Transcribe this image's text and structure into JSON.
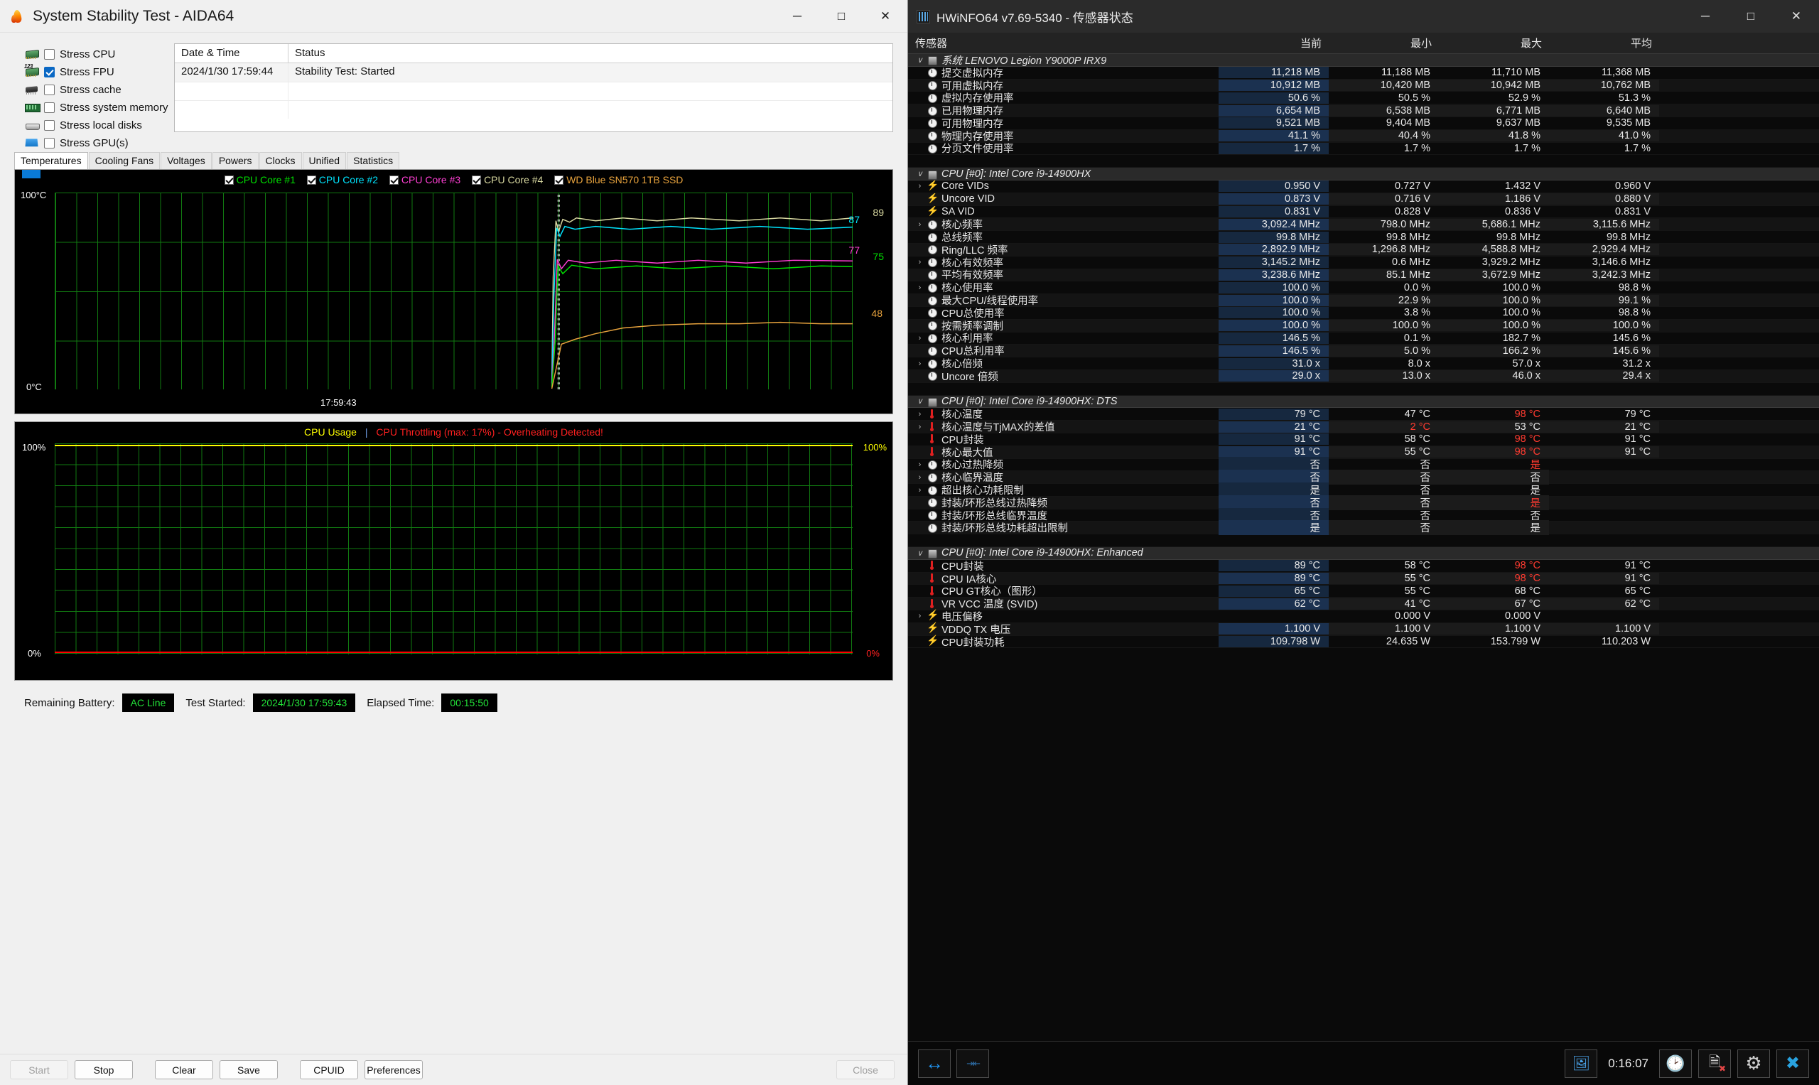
{
  "aida": {
    "title": "System Stability Test - AIDA64",
    "window_buttons": {
      "minimize": "─",
      "maximize": "□",
      "close": "✕"
    },
    "stress_options": [
      {
        "label": "Stress CPU",
        "checked": false,
        "icon": "cpu-icon"
      },
      {
        "label": "Stress FPU",
        "checked": true,
        "icon": "fpu-icon"
      },
      {
        "label": "Stress cache",
        "checked": false,
        "icon": "cache-icon"
      },
      {
        "label": "Stress system memory",
        "checked": false,
        "icon": "memory-icon"
      },
      {
        "label": "Stress local disks",
        "checked": false,
        "icon": "disk-icon"
      },
      {
        "label": "Stress GPU(s)",
        "checked": false,
        "icon": "gpu-icon"
      }
    ],
    "log": {
      "columns": [
        "Date & Time",
        "Status"
      ],
      "rows": [
        {
          "datetime": "2024/1/30 17:59:44",
          "status": "Stability Test: Started"
        }
      ]
    },
    "tabs": [
      {
        "label": "Temperatures",
        "active": true
      },
      {
        "label": "Cooling Fans",
        "active": false
      },
      {
        "label": "Voltages",
        "active": false
      },
      {
        "label": "Powers",
        "active": false
      },
      {
        "label": "Clocks",
        "active": false
      },
      {
        "label": "Unified",
        "active": false
      },
      {
        "label": "Statistics",
        "active": false
      }
    ],
    "temp_graph": {
      "legend": [
        {
          "label": "CPU Core #1",
          "color": "#00e000",
          "checked": true
        },
        {
          "label": "CPU Core #2",
          "color": "#00e5ff",
          "checked": true
        },
        {
          "label": "CPU Core #3",
          "color": "#ff3fd4",
          "checked": true
        },
        {
          "label": "CPU Core #4",
          "color": "#d8d8a0",
          "checked": true
        },
        {
          "label": "WD Blue SN570 1TB SSD",
          "color": "#e8a33d",
          "checked": true
        }
      ],
      "y_max_label": "100°C",
      "y_min_label": "0°C",
      "x_label": "17:59:43",
      "value_labels": [
        {
          "value": "89",
          "color": "#d8d8a0"
        },
        {
          "value": "87",
          "color": "#00e5ff"
        },
        {
          "value": "77",
          "color": "#ff3fd4"
        },
        {
          "value": "75",
          "color": "#00e000"
        },
        {
          "value": "48",
          "color": "#e8a33d"
        }
      ]
    },
    "usage_graph": {
      "title": "CPU Usage",
      "separator": "|",
      "warning": "CPU Throttling (max: 17%) - Overheating Detected!",
      "y_max_label": "100%",
      "y_min_label": "0%",
      "right_max_label": "100%",
      "right_min_label": "0%"
    },
    "status": {
      "battery_label": "Remaining Battery:",
      "battery_value": "AC Line",
      "started_label": "Test Started:",
      "started_value": "2024/1/30 17:59:43",
      "elapsed_label": "Elapsed Time:",
      "elapsed_value": "00:15:50"
    },
    "buttons": [
      {
        "label": "Start",
        "disabled": true
      },
      {
        "label": "Stop",
        "disabled": false
      },
      {
        "label": "Clear",
        "disabled": false
      },
      {
        "label": "Save",
        "disabled": false
      },
      {
        "label": "CPUID",
        "disabled": false
      },
      {
        "label": "Preferences",
        "disabled": false
      },
      {
        "label": "Close",
        "disabled": true
      }
    ]
  },
  "hwinfo": {
    "title": "HWiNFO64 v7.69-5340 - 传感器状态",
    "window_buttons": {
      "minimize": "─",
      "maximize": "□",
      "close": "✕"
    },
    "columns": [
      "传感器",
      "当前",
      "最小",
      "最大",
      "平均"
    ],
    "rows": [
      {
        "type": "group",
        "icon": "chip-icon",
        "name": "系统 LENOVO Legion Y9000P IRX9",
        "expand": "∨"
      },
      {
        "type": "row",
        "icon": "gauge-icon",
        "name": "提交虚拟内存",
        "cur": "11,218 MB",
        "min": "11,188 MB",
        "max": "11,710 MB",
        "avg": "11,368 MB"
      },
      {
        "type": "row",
        "icon": "gauge-icon",
        "name": "可用虚拟内存",
        "cur": "10,912 MB",
        "min": "10,420 MB",
        "max": "10,942 MB",
        "avg": "10,762 MB"
      },
      {
        "type": "row",
        "icon": "gauge-icon",
        "name": "虚拟内存使用率",
        "cur": "50.6 %",
        "min": "50.5 %",
        "max": "52.9 %",
        "avg": "51.3 %"
      },
      {
        "type": "row",
        "icon": "gauge-icon",
        "name": "已用物理内存",
        "cur": "6,654 MB",
        "min": "6,538 MB",
        "max": "6,771 MB",
        "avg": "6,640 MB"
      },
      {
        "type": "row",
        "icon": "gauge-icon",
        "name": "可用物理内存",
        "cur": "9,521 MB",
        "min": "9,404 MB",
        "max": "9,637 MB",
        "avg": "9,535 MB"
      },
      {
        "type": "row",
        "icon": "gauge-icon",
        "name": "物理内存使用率",
        "cur": "41.1 %",
        "min": "40.4 %",
        "max": "41.8 %",
        "avg": "41.0 %"
      },
      {
        "type": "row",
        "icon": "gauge-icon",
        "name": "分页文件使用率",
        "cur": "1.7 %",
        "min": "1.7 %",
        "max": "1.7 %",
        "avg": "1.7 %"
      },
      {
        "type": "spacer"
      },
      {
        "type": "group",
        "icon": "chip-icon",
        "name": "CPU [#0]: Intel Core i9-14900HX",
        "expand": "∨"
      },
      {
        "type": "row",
        "icon": "bolt-icon",
        "expand": "›",
        "name": "Core VIDs",
        "cur": "0.950 V",
        "min": "0.727 V",
        "max": "1.432 V",
        "avg": "0.960 V"
      },
      {
        "type": "row",
        "icon": "bolt-icon",
        "name": "Uncore VID",
        "cur": "0.873 V",
        "min": "0.716 V",
        "max": "1.186 V",
        "avg": "0.880 V"
      },
      {
        "type": "row",
        "icon": "bolt-icon",
        "name": "SA VID",
        "cur": "0.831 V",
        "min": "0.828 V",
        "max": "0.836 V",
        "avg": "0.831 V"
      },
      {
        "type": "row",
        "icon": "gauge-icon",
        "expand": "›",
        "name": "核心频率",
        "cur": "3,092.4 MHz",
        "min": "798.0 MHz",
        "max": "5,686.1 MHz",
        "avg": "3,115.6 MHz"
      },
      {
        "type": "row",
        "icon": "gauge-icon",
        "name": "总线频率",
        "cur": "99.8 MHz",
        "min": "99.8 MHz",
        "max": "99.8 MHz",
        "avg": "99.8 MHz"
      },
      {
        "type": "row",
        "icon": "gauge-icon",
        "name": "Ring/LLC 频率",
        "cur": "2,892.9 MHz",
        "min": "1,296.8 MHz",
        "max": "4,588.8 MHz",
        "avg": "2,929.4 MHz"
      },
      {
        "type": "row",
        "icon": "gauge-icon",
        "expand": "›",
        "name": "核心有效频率",
        "cur": "3,145.2 MHz",
        "min": "0.6 MHz",
        "max": "3,929.2 MHz",
        "avg": "3,146.6 MHz"
      },
      {
        "type": "row",
        "icon": "gauge-icon",
        "name": "平均有效频率",
        "cur": "3,238.6 MHz",
        "min": "85.1 MHz",
        "max": "3,672.9 MHz",
        "avg": "3,242.3 MHz"
      },
      {
        "type": "row",
        "icon": "gauge-icon",
        "expand": "›",
        "name": "核心使用率",
        "cur": "100.0 %",
        "min": "0.0 %",
        "max": "100.0 %",
        "avg": "98.8 %"
      },
      {
        "type": "row",
        "icon": "gauge-icon",
        "name": "最大CPU/线程使用率",
        "cur": "100.0 %",
        "min": "22.9 %",
        "max": "100.0 %",
        "avg": "99.1 %"
      },
      {
        "type": "row",
        "icon": "gauge-icon",
        "name": "CPU总使用率",
        "cur": "100.0 %",
        "min": "3.8 %",
        "max": "100.0 %",
        "avg": "98.8 %"
      },
      {
        "type": "row",
        "icon": "gauge-icon",
        "name": "按需频率调制",
        "cur": "100.0 %",
        "min": "100.0 %",
        "max": "100.0 %",
        "avg": "100.0 %"
      },
      {
        "type": "row",
        "icon": "gauge-icon",
        "expand": "›",
        "name": "核心利用率",
        "cur": "146.5 %",
        "min": "0.1 %",
        "max": "182.7 %",
        "avg": "145.6 %"
      },
      {
        "type": "row",
        "icon": "gauge-icon",
        "name": "CPU总利用率",
        "cur": "146.5 %",
        "min": "5.0 %",
        "max": "166.2 %",
        "avg": "145.6 %"
      },
      {
        "type": "row",
        "icon": "gauge-icon",
        "expand": "›",
        "name": "核心倍频",
        "cur": "31.0 x",
        "min": "8.0 x",
        "max": "57.0 x",
        "avg": "31.2 x"
      },
      {
        "type": "row",
        "icon": "gauge-icon",
        "name": "Uncore 倍频",
        "cur": "29.0 x",
        "min": "13.0 x",
        "max": "46.0 x",
        "avg": "29.4 x"
      },
      {
        "type": "spacer"
      },
      {
        "type": "group",
        "icon": "chip-icon",
        "name": "CPU [#0]: Intel Core i9-14900HX: DTS",
        "expand": "∨"
      },
      {
        "type": "row",
        "icon": "temp-icon",
        "expand": "›",
        "name": "核心温度",
        "cur": "79 °C",
        "min": "47 °C",
        "max": "98 °C",
        "avg": "79 °C",
        "max_red": true
      },
      {
        "type": "row",
        "icon": "temp-icon",
        "expand": "›",
        "name": "核心温度与TjMAX的差值",
        "cur": "21 °C",
        "min": "2 °C",
        "max": "53 °C",
        "avg": "21 °C",
        "min_red": true
      },
      {
        "type": "row",
        "icon": "temp-icon",
        "name": "CPU封装",
        "cur": "91 °C",
        "min": "58 °C",
        "max": "98 °C",
        "avg": "91 °C",
        "max_red": true
      },
      {
        "type": "row",
        "icon": "temp-icon",
        "name": "核心最大值",
        "cur": "91 °C",
        "min": "55 °C",
        "max": "98 °C",
        "avg": "91 °C",
        "max_red": true
      },
      {
        "type": "row",
        "icon": "gauge-icon",
        "expand": "›",
        "name": "核心过热降频",
        "cur": "否",
        "min": "否",
        "max": "是",
        "avg": "",
        "max_red": true
      },
      {
        "type": "row",
        "icon": "gauge-icon",
        "expand": "›",
        "name": "核心临界温度",
        "cur": "否",
        "min": "否",
        "max": "否",
        "avg": ""
      },
      {
        "type": "row",
        "icon": "gauge-icon",
        "expand": "›",
        "name": "超出核心功耗限制",
        "cur": "是",
        "min": "否",
        "max": "是",
        "avg": ""
      },
      {
        "type": "row",
        "icon": "gauge-icon",
        "name": "封装/环形总线过热降频",
        "cur": "否",
        "min": "否",
        "max": "是",
        "avg": "",
        "max_red": true
      },
      {
        "type": "row",
        "icon": "gauge-icon",
        "name": "封装/环形总线临界温度",
        "cur": "否",
        "min": "否",
        "max": "否",
        "avg": ""
      },
      {
        "type": "row",
        "icon": "gauge-icon",
        "name": "封装/环形总线功耗超出限制",
        "cur": "是",
        "min": "否",
        "max": "是",
        "avg": ""
      },
      {
        "type": "spacer"
      },
      {
        "type": "group",
        "icon": "chip-icon",
        "name": "CPU [#0]: Intel Core i9-14900HX: Enhanced",
        "expand": "∨"
      },
      {
        "type": "row",
        "icon": "temp-icon",
        "name": "CPU封装",
        "cur": "89 °C",
        "min": "58 °C",
        "max": "98 °C",
        "avg": "91 °C",
        "max_red": true
      },
      {
        "type": "row",
        "icon": "temp-icon",
        "name": "CPU IA核心",
        "cur": "89 °C",
        "min": "55 °C",
        "max": "98 °C",
        "avg": "91 °C",
        "max_red": true
      },
      {
        "type": "row",
        "icon": "temp-icon",
        "name": "CPU GT核心（图形）",
        "cur": "65 °C",
        "min": "55 °C",
        "max": "68 °C",
        "avg": "65 °C"
      },
      {
        "type": "row",
        "icon": "temp-icon",
        "name": "VR VCC 温度 (SVID)",
        "cur": "62 °C",
        "min": "41 °C",
        "max": "67 °C",
        "avg": "62 °C"
      },
      {
        "type": "row",
        "icon": "bolt-icon",
        "expand": "›",
        "name": "电压偏移",
        "cur": "",
        "min": "0.000 V",
        "max": "0.000 V",
        "avg": ""
      },
      {
        "type": "row",
        "icon": "bolt-icon",
        "name": "VDDQ TX 电压",
        "cur": "1.100 V",
        "min": "1.100 V",
        "max": "1.100 V",
        "avg": "1.100 V"
      },
      {
        "type": "row",
        "icon": "bolt-icon",
        "name": "CPU封装功耗",
        "cur": "109.798 W",
        "min": "24.635 W",
        "max": "153.799 W",
        "avg": "110.203 W"
      }
    ],
    "footer": {
      "timer": "0:16:07",
      "buttons": [
        "expand-columns-button",
        "collapse-columns-button",
        "snapshot-button",
        "clock-button",
        "clear-log-button",
        "settings-button",
        "close-button"
      ]
    }
  },
  "chart_data": [
    {
      "type": "line",
      "title": "Temperatures",
      "ylabel": "°C",
      "ylim": [
        0,
        100
      ],
      "xlabel": "17:59:43",
      "series": [
        {
          "name": "CPU Core #1",
          "color": "#00e000",
          "final_value": 75
        },
        {
          "name": "CPU Core #2",
          "color": "#00e5ff",
          "final_value": 87
        },
        {
          "name": "CPU Core #3",
          "color": "#ff3fd4",
          "final_value": 77
        },
        {
          "name": "CPU Core #4",
          "color": "#d8d8a0",
          "final_value": 89
        },
        {
          "name": "WD Blue SN570 1TB SSD",
          "color": "#e8a33d",
          "final_value": 48
        }
      ],
      "grid": true,
      "legend": "top"
    },
    {
      "type": "line",
      "title": "CPU Usage",
      "annotation": "CPU Throttling (max: 17%) - Overheating Detected!",
      "ylim": [
        0,
        100
      ],
      "ylabel": "%",
      "series": [
        {
          "name": "CPU Usage",
          "color": "#ffff00",
          "final_value": 100
        },
        {
          "name": "CPU Throttling",
          "color": "#ff0000",
          "final_value": 0
        }
      ],
      "grid": true
    }
  ]
}
